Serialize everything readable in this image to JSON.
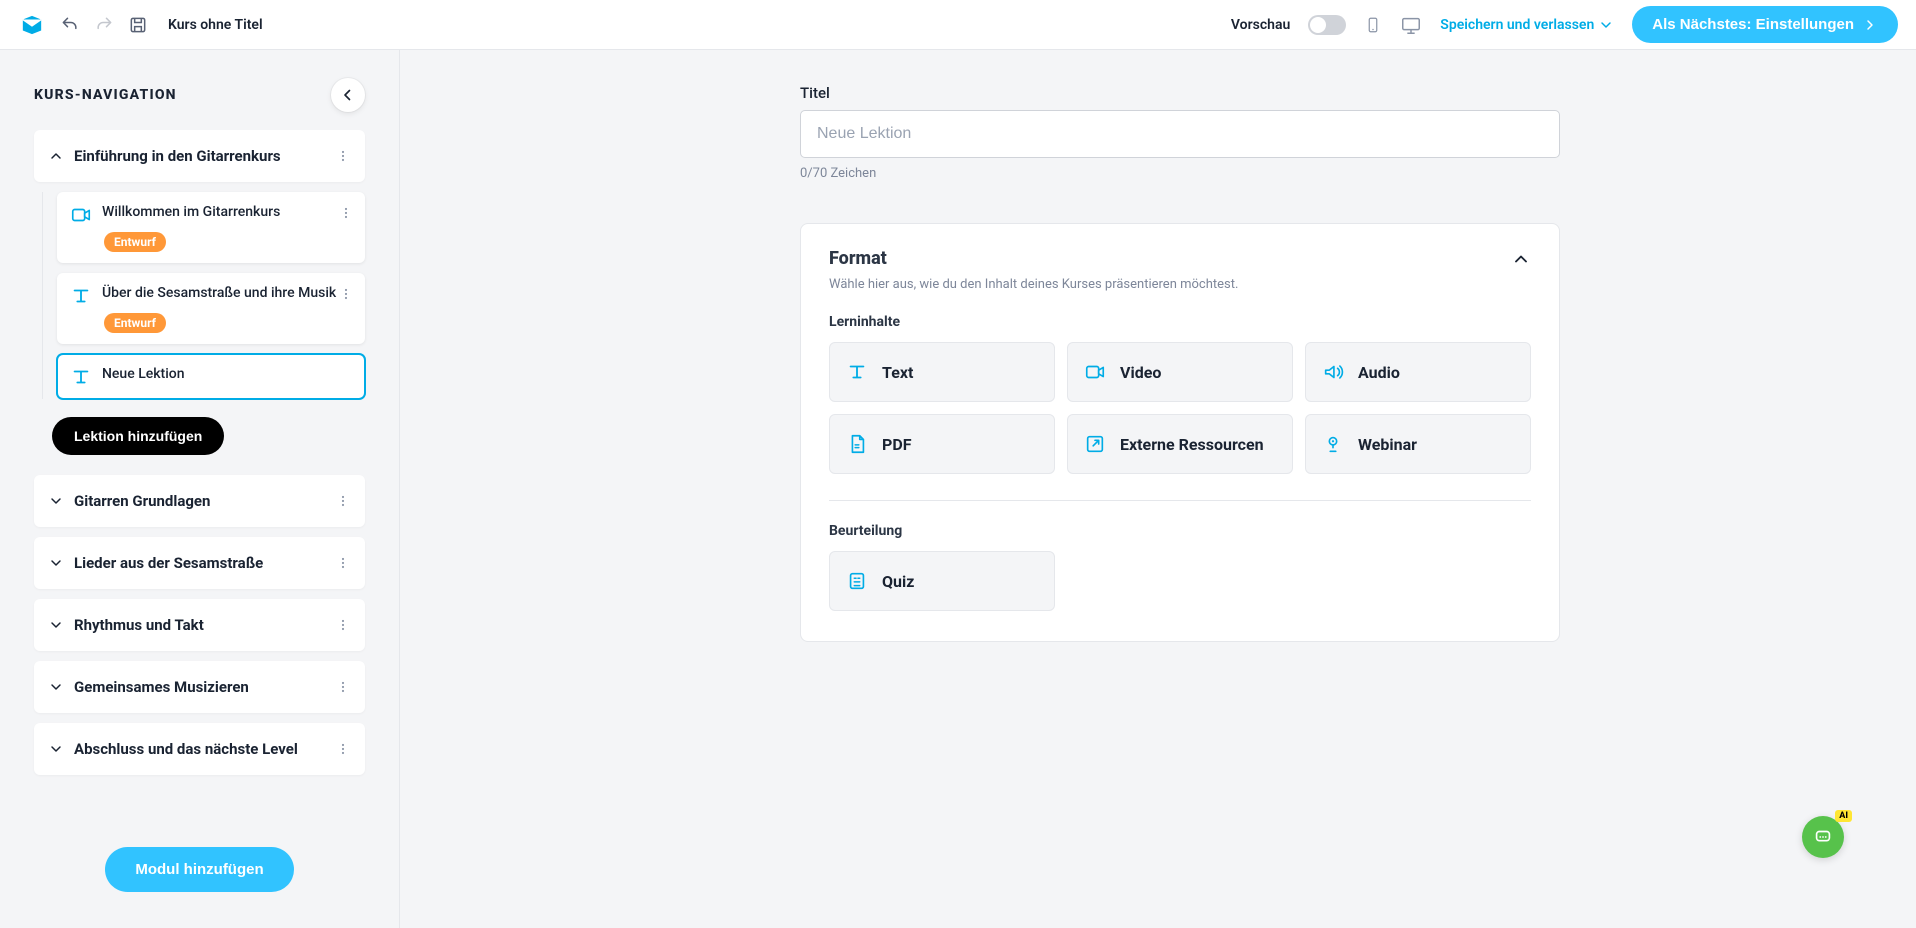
{
  "topbar": {
    "course_title": "Kurs ohne Titel",
    "preview_label": "Vorschau",
    "save_exit_label": "Speichern und verlassen",
    "next_button_label": "Als Nächstes: Einstellungen"
  },
  "sidebar": {
    "heading": "KURS-NAVIGATION",
    "add_lesson_label": "Lektion hinzufügen",
    "add_module_label": "Modul hinzufügen",
    "draft_badge_label": "Entwurf",
    "modules": [
      {
        "title": "Einführung in den Gitarrenkurs",
        "expanded": true,
        "lessons": [
          {
            "title": "Willkommen im Gitarrenkurs",
            "icon": "video",
            "draft": true,
            "active": false
          },
          {
            "title": "Über die Sesamstraße und ihre Musik",
            "icon": "text",
            "draft": true,
            "active": false
          },
          {
            "title": "Neue Lektion",
            "icon": "text",
            "draft": false,
            "active": true
          }
        ]
      },
      {
        "title": "Gitarren Grundlagen",
        "expanded": false,
        "lessons": []
      },
      {
        "title": "Lieder aus der Sesamstraße",
        "expanded": false,
        "lessons": []
      },
      {
        "title": "Rhythmus und Takt",
        "expanded": false,
        "lessons": []
      },
      {
        "title": "Gemeinsames Musizieren",
        "expanded": false,
        "lessons": []
      },
      {
        "title": "Abschluss und das nächste Level",
        "expanded": false,
        "lessons": []
      }
    ]
  },
  "main": {
    "title_label": "Titel",
    "title_placeholder": "Neue Lektion",
    "title_value": "",
    "title_counter": "0/70 Zeichen",
    "format": {
      "heading": "Format",
      "description": "Wähle hier aus, wie du den Inhalt deines Kurses präsentieren möchtest.",
      "content_label": "Lerninhalte",
      "assessment_label": "Beurteilung",
      "content_items": [
        {
          "label": "Text",
          "icon": "text"
        },
        {
          "label": "Video",
          "icon": "video"
        },
        {
          "label": "Audio",
          "icon": "audio"
        },
        {
          "label": "PDF",
          "icon": "pdf"
        },
        {
          "label": "Externe Ressourcen",
          "icon": "external"
        },
        {
          "label": "Webinar",
          "icon": "webinar"
        }
      ],
      "assessment_items": [
        {
          "label": "Quiz",
          "icon": "quiz"
        }
      ]
    }
  },
  "ai": {
    "badge": "AI"
  }
}
